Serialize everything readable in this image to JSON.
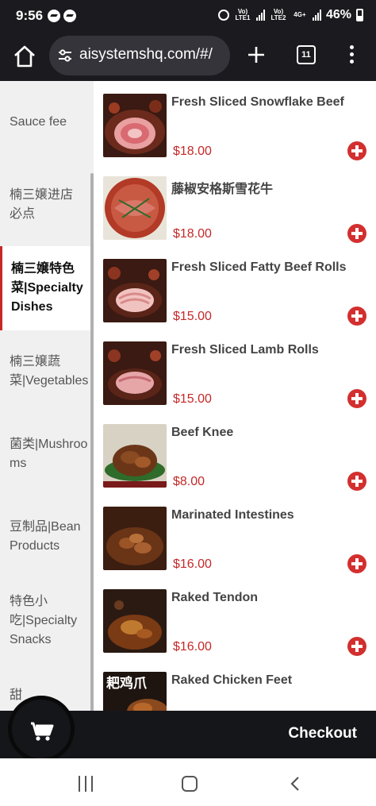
{
  "status_bar": {
    "time": "9:56",
    "net1": "Vo) LTE1",
    "net2": "Vo) LTE2",
    "net_4g": "4G+",
    "battery": "46%"
  },
  "browser": {
    "url": "aisystemshq.com/#/",
    "tab_count": "11"
  },
  "categories": [
    {
      "label": "Sauce fee",
      "active": false
    },
    {
      "label": "楠三嬢进店必点",
      "active": false
    },
    {
      "label": "楠三嬢特色菜|Specialty Dishes",
      "active": true
    },
    {
      "label": "楠三嬢蔬菜|Vegetables",
      "active": false
    },
    {
      "label": "菌类|Mushrooms",
      "active": false
    },
    {
      "label": "豆制品|Bean Products",
      "active": false
    },
    {
      "label": "特色小吃|Specialty Snacks",
      "active": false
    },
    {
      "label": "甜",
      "active": false
    }
  ],
  "products": [
    {
      "name": "Fresh Sliced Snowflake Beef",
      "price": "$18.00"
    },
    {
      "name": "藤椒安格斯雪花牛",
      "price": "$18.00"
    },
    {
      "name": "Fresh Sliced Fatty Beef Rolls",
      "price": "$15.00"
    },
    {
      "name": "Fresh Sliced Lamb Rolls",
      "price": "$15.00"
    },
    {
      "name": "Beef Knee",
      "price": "$8.00"
    },
    {
      "name": "Marinated Intestines",
      "price": "$16.00"
    },
    {
      "name": "Raked Tendon",
      "price": "$16.00"
    },
    {
      "name": "Raked Chicken Feet",
      "price": ""
    }
  ],
  "chicken_feet_image_text": "耙鸡爪",
  "checkout_label": "Checkout",
  "colors": {
    "accent": "#c62828",
    "dark_bar": "#15161a"
  }
}
